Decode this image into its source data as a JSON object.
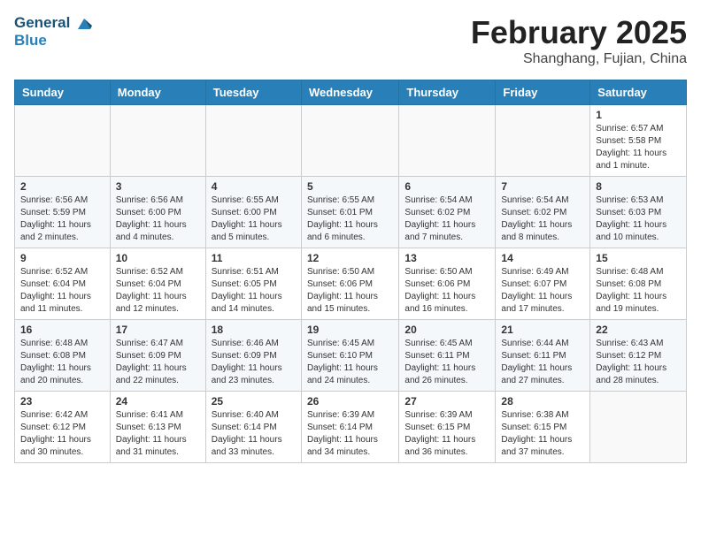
{
  "logo": {
    "line1": "General",
    "line2": "Blue"
  },
  "title": "February 2025",
  "subtitle": "Shanghang, Fujian, China",
  "days_of_week": [
    "Sunday",
    "Monday",
    "Tuesday",
    "Wednesday",
    "Thursday",
    "Friday",
    "Saturday"
  ],
  "weeks": [
    [
      {
        "day": "",
        "info": ""
      },
      {
        "day": "",
        "info": ""
      },
      {
        "day": "",
        "info": ""
      },
      {
        "day": "",
        "info": ""
      },
      {
        "day": "",
        "info": ""
      },
      {
        "day": "",
        "info": ""
      },
      {
        "day": "1",
        "info": "Sunrise: 6:57 AM\nSunset: 5:58 PM\nDaylight: 11 hours\nand 1 minute."
      }
    ],
    [
      {
        "day": "2",
        "info": "Sunrise: 6:56 AM\nSunset: 5:59 PM\nDaylight: 11 hours\nand 2 minutes."
      },
      {
        "day": "3",
        "info": "Sunrise: 6:56 AM\nSunset: 6:00 PM\nDaylight: 11 hours\nand 4 minutes."
      },
      {
        "day": "4",
        "info": "Sunrise: 6:55 AM\nSunset: 6:00 PM\nDaylight: 11 hours\nand 5 minutes."
      },
      {
        "day": "5",
        "info": "Sunrise: 6:55 AM\nSunset: 6:01 PM\nDaylight: 11 hours\nand 6 minutes."
      },
      {
        "day": "6",
        "info": "Sunrise: 6:54 AM\nSunset: 6:02 PM\nDaylight: 11 hours\nand 7 minutes."
      },
      {
        "day": "7",
        "info": "Sunrise: 6:54 AM\nSunset: 6:02 PM\nDaylight: 11 hours\nand 8 minutes."
      },
      {
        "day": "8",
        "info": "Sunrise: 6:53 AM\nSunset: 6:03 PM\nDaylight: 11 hours\nand 10 minutes."
      }
    ],
    [
      {
        "day": "9",
        "info": "Sunrise: 6:52 AM\nSunset: 6:04 PM\nDaylight: 11 hours\nand 11 minutes."
      },
      {
        "day": "10",
        "info": "Sunrise: 6:52 AM\nSunset: 6:04 PM\nDaylight: 11 hours\nand 12 minutes."
      },
      {
        "day": "11",
        "info": "Sunrise: 6:51 AM\nSunset: 6:05 PM\nDaylight: 11 hours\nand 14 minutes."
      },
      {
        "day": "12",
        "info": "Sunrise: 6:50 AM\nSunset: 6:06 PM\nDaylight: 11 hours\nand 15 minutes."
      },
      {
        "day": "13",
        "info": "Sunrise: 6:50 AM\nSunset: 6:06 PM\nDaylight: 11 hours\nand 16 minutes."
      },
      {
        "day": "14",
        "info": "Sunrise: 6:49 AM\nSunset: 6:07 PM\nDaylight: 11 hours\nand 17 minutes."
      },
      {
        "day": "15",
        "info": "Sunrise: 6:48 AM\nSunset: 6:08 PM\nDaylight: 11 hours\nand 19 minutes."
      }
    ],
    [
      {
        "day": "16",
        "info": "Sunrise: 6:48 AM\nSunset: 6:08 PM\nDaylight: 11 hours\nand 20 minutes."
      },
      {
        "day": "17",
        "info": "Sunrise: 6:47 AM\nSunset: 6:09 PM\nDaylight: 11 hours\nand 22 minutes."
      },
      {
        "day": "18",
        "info": "Sunrise: 6:46 AM\nSunset: 6:09 PM\nDaylight: 11 hours\nand 23 minutes."
      },
      {
        "day": "19",
        "info": "Sunrise: 6:45 AM\nSunset: 6:10 PM\nDaylight: 11 hours\nand 24 minutes."
      },
      {
        "day": "20",
        "info": "Sunrise: 6:45 AM\nSunset: 6:11 PM\nDaylight: 11 hours\nand 26 minutes."
      },
      {
        "day": "21",
        "info": "Sunrise: 6:44 AM\nSunset: 6:11 PM\nDaylight: 11 hours\nand 27 minutes."
      },
      {
        "day": "22",
        "info": "Sunrise: 6:43 AM\nSunset: 6:12 PM\nDaylight: 11 hours\nand 28 minutes."
      }
    ],
    [
      {
        "day": "23",
        "info": "Sunrise: 6:42 AM\nSunset: 6:12 PM\nDaylight: 11 hours\nand 30 minutes."
      },
      {
        "day": "24",
        "info": "Sunrise: 6:41 AM\nSunset: 6:13 PM\nDaylight: 11 hours\nand 31 minutes."
      },
      {
        "day": "25",
        "info": "Sunrise: 6:40 AM\nSunset: 6:14 PM\nDaylight: 11 hours\nand 33 minutes."
      },
      {
        "day": "26",
        "info": "Sunrise: 6:39 AM\nSunset: 6:14 PM\nDaylight: 11 hours\nand 34 minutes."
      },
      {
        "day": "27",
        "info": "Sunrise: 6:39 AM\nSunset: 6:15 PM\nDaylight: 11 hours\nand 36 minutes."
      },
      {
        "day": "28",
        "info": "Sunrise: 6:38 AM\nSunset: 6:15 PM\nDaylight: 11 hours\nand 37 minutes."
      },
      {
        "day": "",
        "info": ""
      }
    ]
  ]
}
